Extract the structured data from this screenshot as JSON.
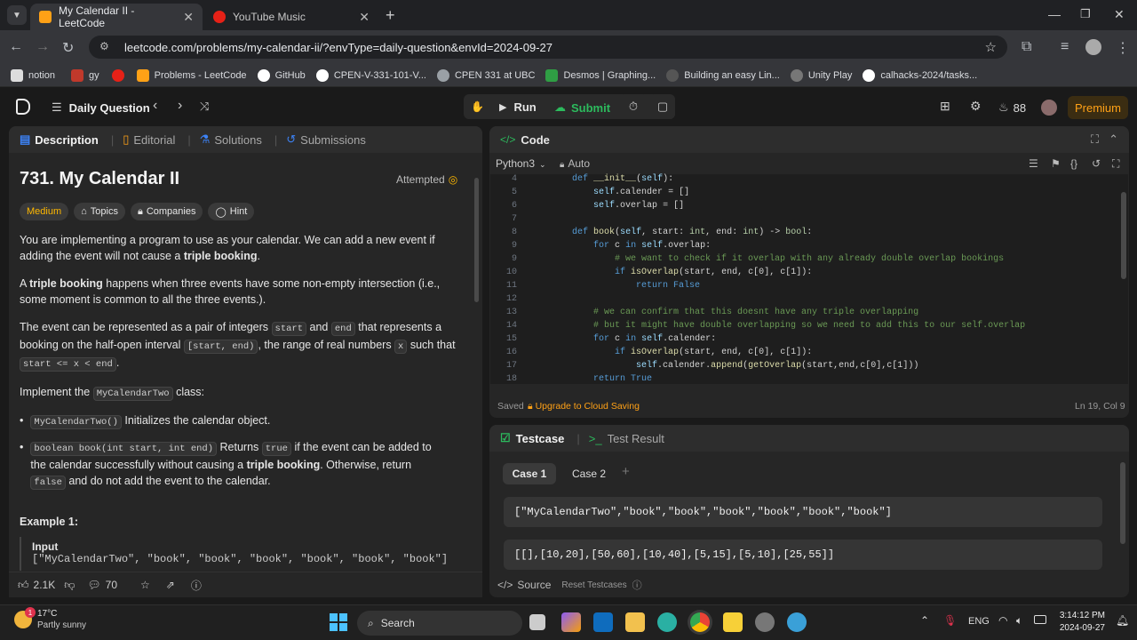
{
  "browser": {
    "tabs": [
      {
        "title": "My Calendar II - LeetCode",
        "active": true
      },
      {
        "title": "YouTube Music",
        "active": false
      }
    ],
    "url": "leetcode.com/problems/my-calendar-ii/?envType=daily-question&envId=2024-09-27",
    "bookmarks": [
      "notion",
      "gy",
      "",
      "Problems - LeetCode",
      "GitHub",
      "CPEN-V-331-101-V...",
      "CPEN 331 at UBC",
      "Desmos | Graphing...",
      "Building an easy Lin...",
      "Unity Play",
      "calhacks-2024/tasks..."
    ]
  },
  "header": {
    "daily_question": "Daily Question",
    "run": "Run",
    "submit": "Submit",
    "streak": "88",
    "premium": "Premium"
  },
  "description_panel": {
    "tabs": [
      "Description",
      "Editorial",
      "Solutions",
      "Submissions"
    ],
    "title": "731. My Calendar II",
    "status": "Attempted",
    "difficulty": "Medium",
    "tags": [
      "Topics",
      "Companies",
      "Hint"
    ],
    "p1a": "You are implementing a program to use as your calendar. We can add a new event if adding the event will not cause a ",
    "p1b": "triple booking",
    "p1c": ".",
    "p2a": "A ",
    "p2b": "triple booking",
    "p2c": " happens when three events have some non-empty intersection (i.e., some moment is common to all the three events.).",
    "p3a": "The event can be represented as a pair of integers ",
    "p3_start": "start",
    "p3b": " and ",
    "p3_end": "end",
    "p3c": " that represents a booking on the half-open interval ",
    "p3_interval": "[start, end)",
    "p3d": ", the range of real numbers ",
    "p3_x": "x",
    "p3e": " such that ",
    "p3_cond": "start <= x < end",
    "p3f": ".",
    "p4a": "Implement the ",
    "p4_class": "MyCalendarTwo",
    "p4b": " class:",
    "li1_code": "MyCalendarTwo()",
    "li1_text": " Initializes the calendar object.",
    "li2_code": "boolean book(int start, int end)",
    "li2_a": " Returns ",
    "li2_true": "true",
    "li2_b": " if the event can be added to the calendar successfully without causing a ",
    "li2_bold": "triple booking",
    "li2_c": ". Otherwise, return ",
    "li2_false": "false",
    "li2_d": " and do not add the event to the calendar.",
    "example_title": "Example 1:",
    "input_label": "Input",
    "input_value": "[\"MyCalendarTwo\", \"book\", \"book\", \"book\", \"book\", \"book\", \"book\"]",
    "likes": "2.1K",
    "comments": "70"
  },
  "code_panel": {
    "title": "Code",
    "language": "Python3",
    "mode": "Auto",
    "lines": [
      {
        "n": "4",
        "html": "    def __init__(self):"
      },
      {
        "n": "5",
        "html": "        self.calender = []"
      },
      {
        "n": "6",
        "html": "        self.overlap = []"
      },
      {
        "n": "7",
        "html": ""
      },
      {
        "n": "8",
        "html": "    def book(self, start: int, end: int) -> bool:"
      },
      {
        "n": "9",
        "html": "        for c in self.overlap:"
      },
      {
        "n": "9",
        "html": "            # we want to check if it overlap with any already double overlap bookings"
      },
      {
        "n": "10",
        "html": "            if isOverlap(start, end, c[0], c[1]):"
      },
      {
        "n": "11",
        "html": "                return False"
      },
      {
        "n": "12",
        "html": ""
      },
      {
        "n": "13",
        "html": "        # we can confirm that this doesnt have any triple overlapping"
      },
      {
        "n": "14",
        "html": "        # but it might have double overlapping so we need to add this to our self.overlap"
      },
      {
        "n": "15",
        "html": "        for c in self.calender:"
      },
      {
        "n": "16",
        "html": "            if isOverlap(start, end, c[0], c[1]):"
      },
      {
        "n": "17",
        "html": "                self.calender.append(getOverlap(start,end,c[0],c[1]))"
      },
      {
        "n": "18",
        "html": "        return True"
      }
    ],
    "saved": "Saved",
    "upgrade": "Upgrade to Cloud Saving",
    "cursor_pos": "Ln 19, Col 9"
  },
  "testcase_panel": {
    "tabs": [
      "Testcase",
      "Test Result"
    ],
    "cases": [
      "Case 1",
      "Case 2"
    ],
    "input1": "[\"MyCalendarTwo\",\"book\",\"book\",\"book\",\"book\",\"book\",\"book\"]",
    "input2": "[[],[10,20],[50,60],[10,40],[5,15],[5,10],[25,55]]",
    "source": "Source",
    "reset": "Reset Testcases"
  },
  "taskbar": {
    "temp": "17°C",
    "weather": "Partly sunny",
    "search": "Search",
    "lang": "ENG",
    "time": "3:14:12 PM",
    "date": "2024-09-27",
    "badge": "1"
  },
  "colors": {
    "accent": "#ffa116",
    "green": "#2cbb5d",
    "medium": "#ffb800"
  }
}
